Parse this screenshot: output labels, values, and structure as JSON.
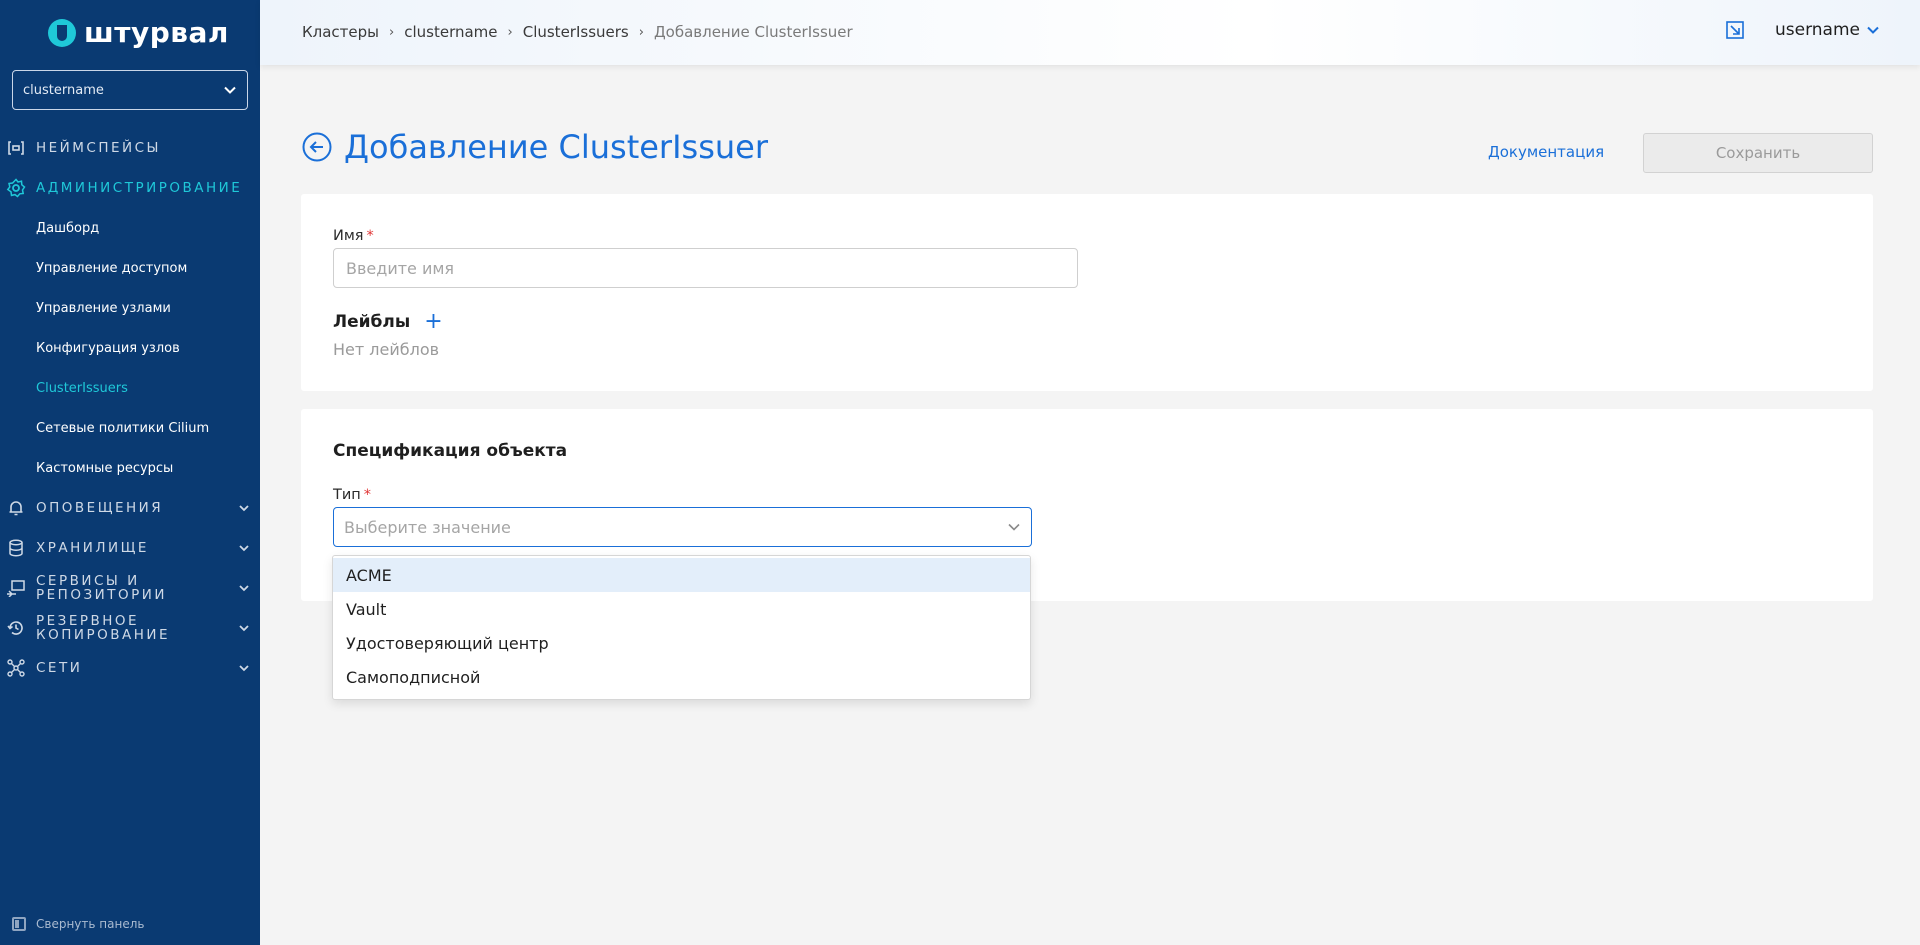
{
  "app": {
    "logo_text": "штурвал"
  },
  "sidebar": {
    "cluster_select": {
      "value": "clustername"
    },
    "sections": [
      {
        "label": "Неймспейсы",
        "icon": "namespace-icon"
      },
      {
        "label": "Администрирование",
        "icon": "gear-icon",
        "expanded": true
      },
      {
        "label": "Оповещения",
        "icon": "bell-icon"
      },
      {
        "label": "Хранилище",
        "icon": "database-icon"
      },
      {
        "label_line1": "Сервисы и",
        "label_line2": "репозитории",
        "icon": "services-icon"
      },
      {
        "label_line1": "Резервное",
        "label_line2": "копирование",
        "icon": "backup-icon"
      },
      {
        "label": "Сети",
        "icon": "network-icon"
      }
    ],
    "admin_items": [
      {
        "label": "Дашборд"
      },
      {
        "label": "Управление доступом"
      },
      {
        "label": "Управление узлами"
      },
      {
        "label": "Конфигурация узлов"
      },
      {
        "label": "ClusterIssuers",
        "active": true
      },
      {
        "label": "Сетевые политики Cilium"
      },
      {
        "label": "Кастомные ресурсы"
      }
    ],
    "collapse_label": "Свернуть панель"
  },
  "header": {
    "breadcrumb": [
      "Кластеры",
      "clustername",
      "ClusterIssuers",
      "Добавление ClusterIssuer"
    ],
    "username": "username"
  },
  "page": {
    "title": "Добавление ClusterIssuer",
    "doc_link": "Документация",
    "save_label": "Сохранить"
  },
  "form": {
    "name_label": "Имя",
    "name_placeholder": "Введите имя",
    "labels_title": "Лейблы",
    "labels_empty": "Нет лейблов",
    "spec_title": "Спецификация объекта",
    "type_label": "Тип",
    "type_placeholder": "Выберите значение",
    "type_options": [
      "ACME",
      "Vault",
      "Удостоверяющий центр",
      "Самоподписной"
    ]
  },
  "colors": {
    "sidebar_bg": "#0a3a72",
    "accent": "#1a6fd8",
    "active_nav": "#1fc8d8",
    "required": "#e03434"
  }
}
